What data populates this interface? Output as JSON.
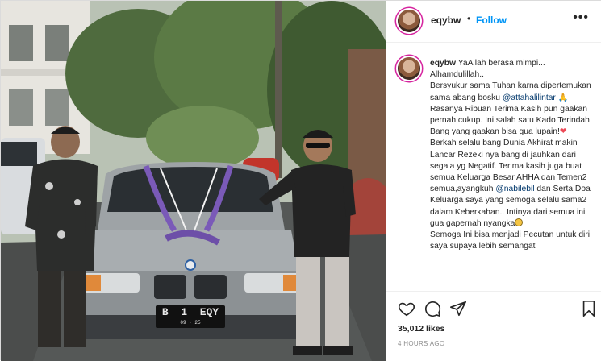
{
  "post": {
    "username": "eqybw",
    "follow_label": "Follow",
    "separator": "•",
    "more_label": "•••",
    "plate_text": "B  1  EQY",
    "plate_sub": "09 · 25",
    "caption": {
      "line1": "YaAllah berasa mimpi...",
      "line2": "Alhamdulillah..",
      "p1_a": "Bersyukur sama Tuhan karna dipertemukan sama abang bosku",
      "mention1": "@attahalilintar",
      "p1_b": " 🙏 Rasanya Ribuan Terima Kasih pun gaakan pernah cukup. Ini salah satu Kado Terindah Bang yang gaakan bisa gua lupain!",
      "heart": "❤",
      "p2_a": "Berkah selalu bang Dunia Akhirat makin Lancar Rezeki nya bang di jauhkan dari segala yg Negatif. Terima kasih juga buat semua Keluarga Besar AHHA dan Temen2 semua,ayangkuh",
      "mention2": "@nabilebil",
      "p2_b": " dan Serta Doa Keluarga saya yang semoga selalu sama2 dalam Keberkahan.. Intinya dari semua ini gua gapernah nyangka",
      "p3": "Semoga Ini bisa menjadi Pecutan untuk diri saya supaya lebih semangat"
    },
    "likes": "35,012 likes",
    "time_ago": "4 HOURS AGO",
    "icons": {
      "like": "heart-icon",
      "comment": "comment-icon",
      "share": "paper-plane-icon",
      "save": "bookmark-icon"
    }
  }
}
